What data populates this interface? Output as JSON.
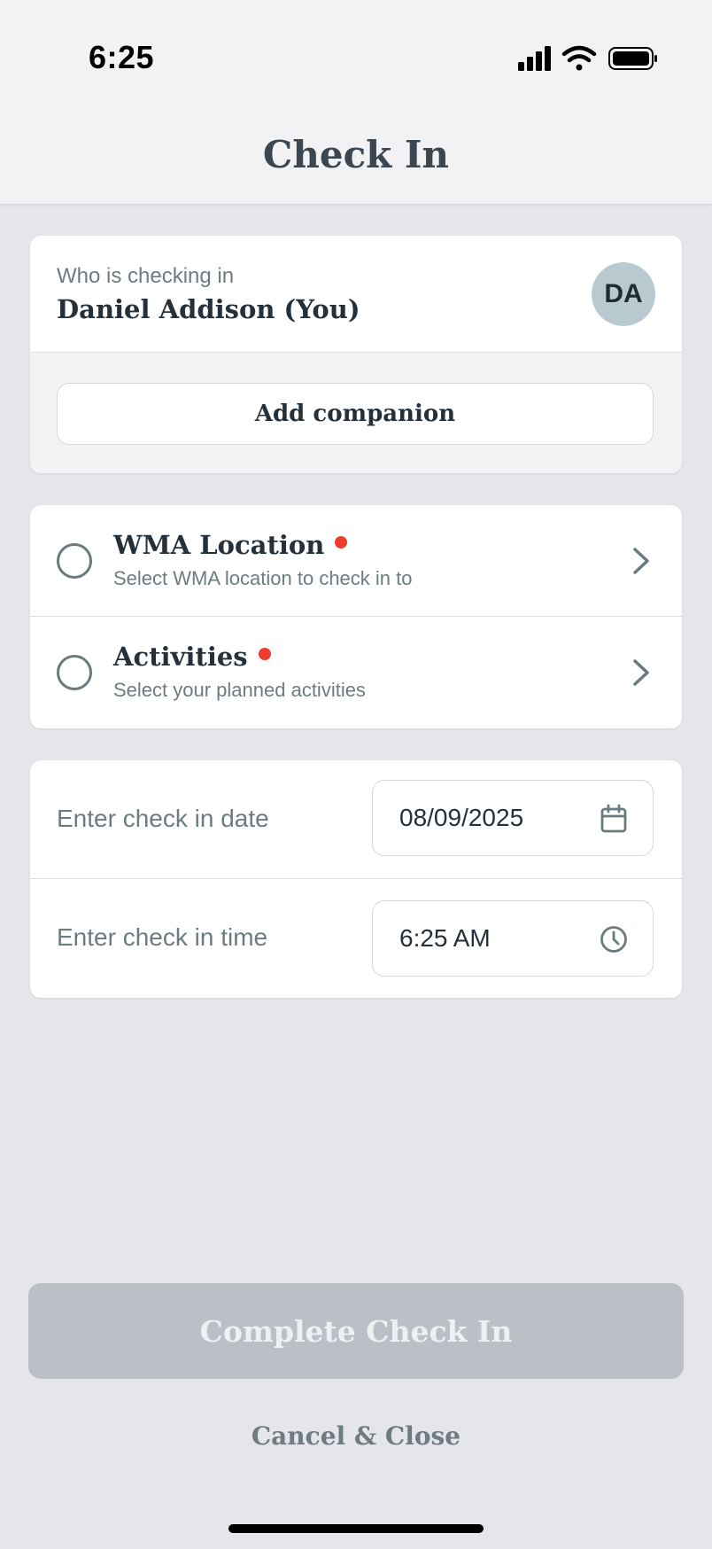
{
  "status_bar": {
    "time": "6:25",
    "icons": [
      "cellular-signal-icon",
      "wifi-icon",
      "battery-icon"
    ]
  },
  "header": {
    "title": "Check In"
  },
  "who": {
    "label": "Who is checking in",
    "name": "Daniel Addison (You)",
    "initials": "DA",
    "avatar_color": "#b8cad0",
    "add_companion_label": "Add companion"
  },
  "selections": [
    {
      "title": "WMA Location",
      "subtitle": "Select WMA location to check in to",
      "required": true
    },
    {
      "title": "Activities",
      "subtitle": "Select your planned activities",
      "required": true
    }
  ],
  "datetime": {
    "date_label": "Enter check in date",
    "date_value": "08/09/2025",
    "time_label": "Enter check in time",
    "time_value": "6:25 AM"
  },
  "actions": {
    "complete_label": "Complete Check In",
    "complete_enabled": false,
    "cancel_label": "Cancel & Close"
  },
  "colors": {
    "required_dot": "#ef3b2d",
    "disabled_button": "#bcc0c6",
    "background": "#e6e6ea"
  }
}
